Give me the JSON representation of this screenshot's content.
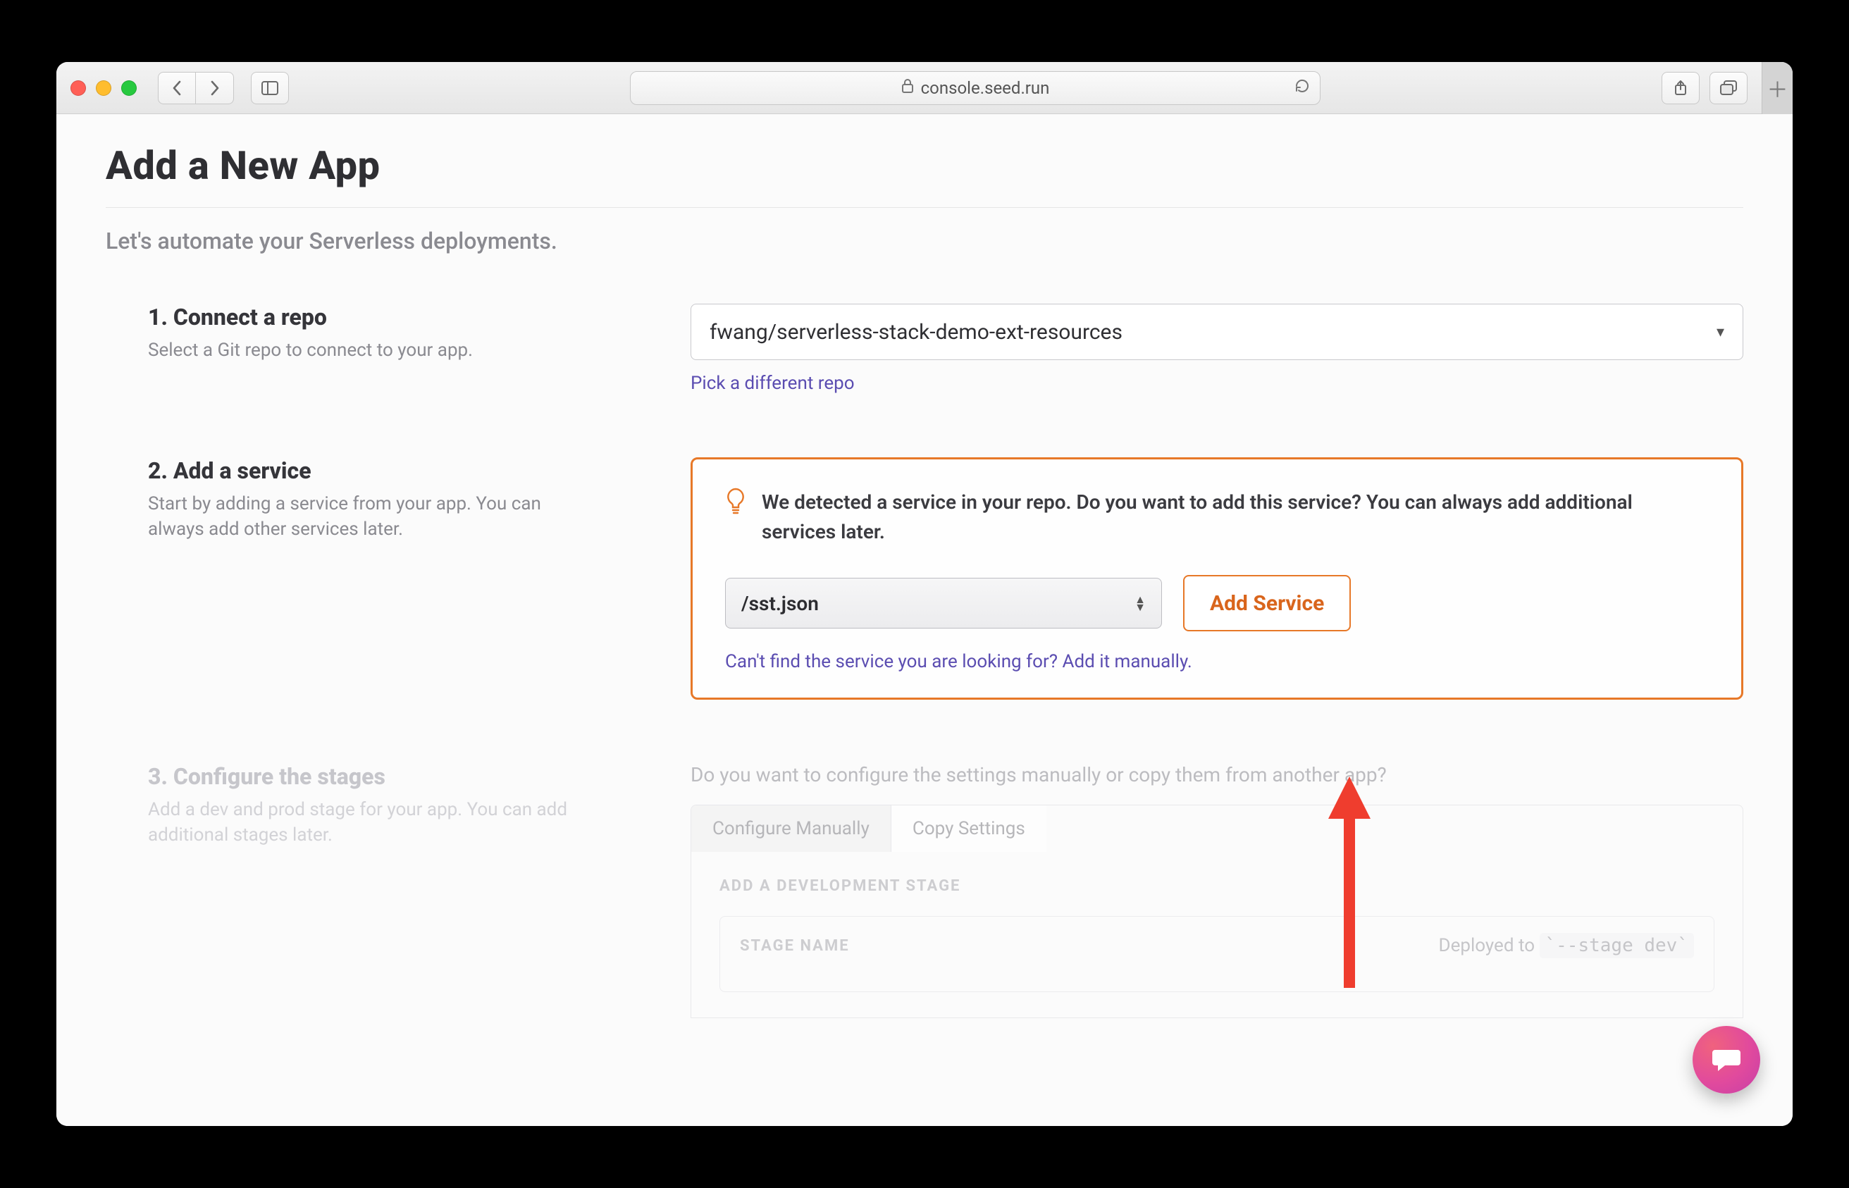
{
  "browser": {
    "url_host": "console.seed.run"
  },
  "page": {
    "title": "Add a New App",
    "subtitle": "Let's automate your Serverless deployments."
  },
  "step1": {
    "title": "1. Connect a repo",
    "desc": "Select a Git repo to connect to your app.",
    "repo": "fwang/serverless-stack-demo-ext-resources",
    "pick_link": "Pick a different repo"
  },
  "step2": {
    "title": "2. Add a service",
    "desc": "Start by adding a service from your app. You can always add other services later.",
    "detected_msg": "We detected a service in your repo. Do you want to add this service? You can always add additional services later.",
    "service_path": "/sst.json",
    "add_btn": "Add Service",
    "manual_hint": "Can't find the service you are looking for? Add it manually."
  },
  "step3": {
    "title": "3. Configure the stages",
    "desc": "Add a dev and prod stage for your app. You can add additional stages later.",
    "question": "Do you want to configure the settings manually or copy them from another app?",
    "tab_manual": "Configure Manually",
    "tab_copy": "Copy Settings",
    "section_label": "ADD A DEVELOPMENT STAGE",
    "stage_name_label": "STAGE NAME",
    "deployed_to_prefix": "Deployed to ",
    "deployed_to_code": "`--stage dev`"
  }
}
